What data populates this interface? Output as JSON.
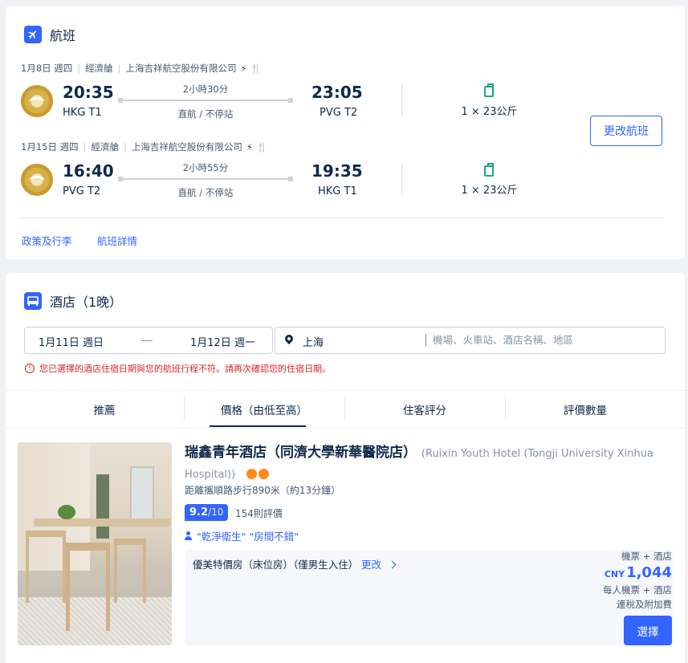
{
  "flight": {
    "title": "航班",
    "segments": [
      {
        "date": "1月8日 週四",
        "cabin": "經濟艙",
        "airline": "上海吉祥航空股份有限公司",
        "depart_time": "20:35",
        "depart_port": "HKG T1",
        "duration": "2小時30分",
        "stops": "直航 / 不停站",
        "arrive_time": "23:05",
        "arrive_port": "PVG T2",
        "baggage": "1 × 23公斤"
      },
      {
        "date": "1月15日 週四",
        "cabin": "經濟艙",
        "airline": "上海吉祥航空股份有限公司",
        "depart_time": "16:40",
        "depart_port": "PVG T2",
        "duration": "2小時55分",
        "stops": "直航 / 不停站",
        "arrive_time": "19:35",
        "arrive_port": "HKG T1",
        "baggage": "1 × 23公斤"
      }
    ],
    "change_button": "更改航班",
    "links": {
      "policy": "政策及行李",
      "details": "航班詳情"
    }
  },
  "hotel": {
    "title": "酒店（1晚）",
    "checkin": "1月11日 週日",
    "checkout": "1月12日 週一",
    "destination": "上海",
    "search_placeholder": "機場、火車站、酒店名稱、地區",
    "warning": "您已選擇的酒店住宿日期與您的航班行程不符。請再次確認您的住宿日期。",
    "tabs": [
      "推薦",
      "價格（由低至高）",
      "住客評分",
      "評價數量"
    ],
    "result": {
      "name": "瑞鑫青年酒店（同濟大學新華醫院店）",
      "name_en": "(Ruixin Youth Hotel (Tongji University Xinhua Hospital))",
      "distance": "距離攜順路步行890米（約13分鐘）",
      "score": "9.2",
      "score_max": "/10",
      "reviews": "154則評價",
      "highlights": "\"乾淨衛生\" \"房間不錯\"",
      "room": "優美特價房（床位房）（僅男生入住）",
      "room_change": "更改",
      "price_label_top": "機票 + 酒店",
      "currency": "CNY",
      "price": "1,044",
      "price_note_1": "每人機票 + 酒店",
      "price_note_2": "連稅及附加費",
      "select_button": "選擇"
    }
  },
  "colors": {
    "accent": "#3264ff",
    "text": "#0f294d",
    "warning": "#d9242a",
    "star": "#ff8a1f",
    "baggage": "#1aa78c"
  }
}
